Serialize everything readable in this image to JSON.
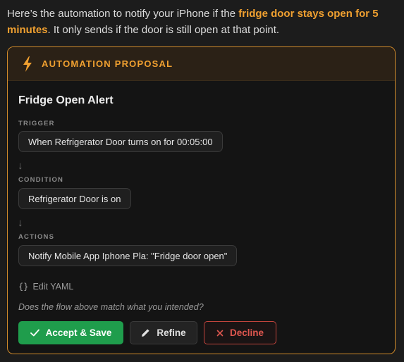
{
  "intro": {
    "part1": "Here’s the automation to notify your iPhone if the ",
    "highlight": "fridge door stays open for 5 minutes",
    "part2": ". It only sends if the door is still open at that point."
  },
  "card": {
    "header_label": "AUTOMATION PROPOSAL",
    "title": "Fridge Open Alert",
    "trigger_label": "TRIGGER",
    "trigger": "When Refrigerator Door turns on for 00:05:00",
    "condition_label": "CONDITION",
    "condition": "Refrigerator Door is on",
    "actions_label": "ACTIONS",
    "action": "Notify Mobile App Iphone Pla: \"Fridge door open\"",
    "arrow": "↓",
    "edit_yaml_icon": "{}",
    "edit_yaml": "Edit YAML",
    "question": "Does the flow above match what you intended?",
    "accept_label": "Accept & Save",
    "refine_label": "Refine",
    "decline_label": "Decline"
  },
  "colors": {
    "accent": "#f0a030",
    "accept": "#1f9d4c",
    "decline": "#e0574f"
  },
  "icons": {
    "header": "lightning-bolt-icon",
    "accept": "checkmark-icon",
    "refine": "pencil-icon",
    "decline": "x-icon",
    "yaml": "braces-icon"
  }
}
